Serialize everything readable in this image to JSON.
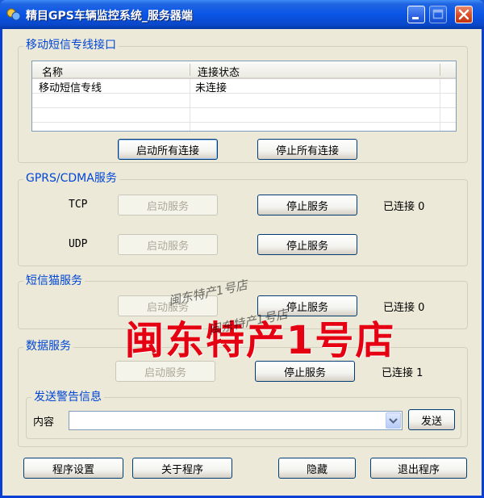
{
  "window": {
    "title": "精目GPS车辆监控系统_服务器端"
  },
  "sms_line": {
    "group_title": "移动短信专线接口",
    "columns": [
      "名称",
      "连接状态"
    ],
    "rows": [
      {
        "name": "移动短信专线",
        "status": "未连接"
      }
    ],
    "start_all_label": "启动所有连接",
    "stop_all_label": "停止所有连接"
  },
  "gprs": {
    "group_title": "GPRS/CDMA服务",
    "tcp_label": "TCP",
    "udp_label": "UDP",
    "tcp_start_label": "启动服务",
    "tcp_stop_label": "停止服务",
    "tcp_status": "已连接 0",
    "udp_start_label": "启动服务",
    "udp_stop_label": "停止服务"
  },
  "sms_cat": {
    "group_title": "短信猫服务",
    "start_label": "启动服务",
    "stop_label": "停止服务",
    "status": "已连接 0"
  },
  "data_service": {
    "group_title": "数据服务",
    "start_label": "启动服务",
    "stop_label": "停止服务",
    "status": "已连接 1",
    "alert": {
      "group_title": "发送警告信息",
      "content_label": "内容",
      "content_value": "",
      "send_label": "发送"
    }
  },
  "footer": {
    "settings_label": "程序设置",
    "about_label": "关于程序",
    "hide_label": "隐藏",
    "exit_label": "退出程序"
  },
  "watermark": {
    "main": "闽东特产1号店",
    "small_1": "闽东特产1号店",
    "small_2": "闽东特产1号店"
  },
  "colors": {
    "titlebar": "#0a55e6",
    "group_title": "#0046d5",
    "watermark": "#e50012"
  }
}
